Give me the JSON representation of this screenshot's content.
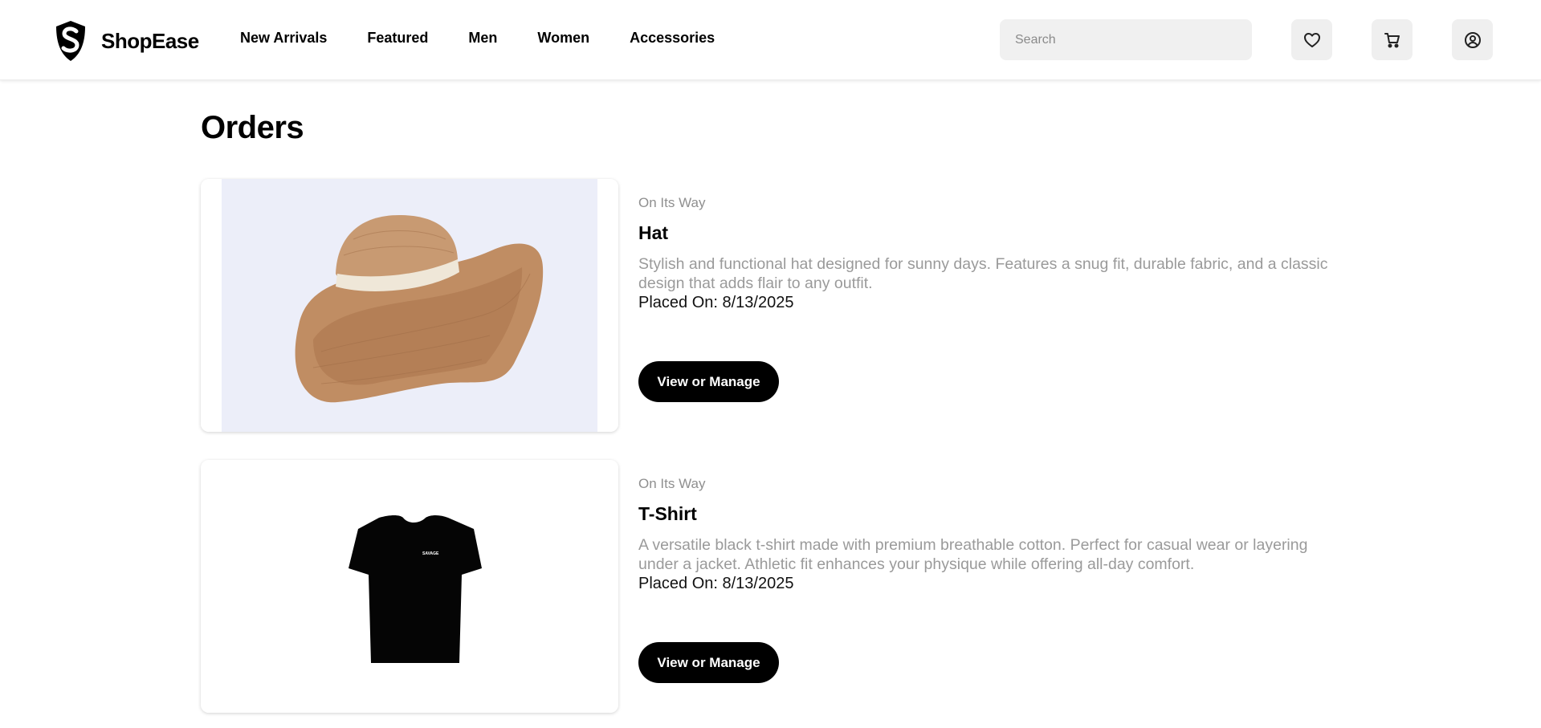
{
  "brand": {
    "name": "ShopEase"
  },
  "nav": [
    "New Arrivals",
    "Featured",
    "Men",
    "Women",
    "Accessories"
  ],
  "search": {
    "placeholder": "Search",
    "value": ""
  },
  "header_icons": [
    "heart-icon",
    "cart-icon",
    "account-icon"
  ],
  "page": {
    "title": "Orders"
  },
  "orders": [
    {
      "status": "On Its Way",
      "name": "Hat",
      "description": "Stylish and functional hat designed for sunny days. Features a snug fit, durable fabric, and a classic design that adds flair to any outfit.",
      "placed": "Placed On: 8/13/2025",
      "button": "View or Manage"
    },
    {
      "status": "On Its Way",
      "name": "T-Shirt",
      "description": "A versatile black t-shirt made with premium breathable cotton. Perfect for casual wear or layering under a jacket. Athletic fit enhances your physique while offering all-day comfort.",
      "placed": "Placed On: 8/13/2025",
      "button": "View or Manage"
    }
  ],
  "product_photos": [
    {
      "subject": "straw sun hat with cream band",
      "background": "#eceef9"
    },
    {
      "subject": "black t-shirt",
      "print": "SAVAGE",
      "background": "#ffffff"
    }
  ]
}
